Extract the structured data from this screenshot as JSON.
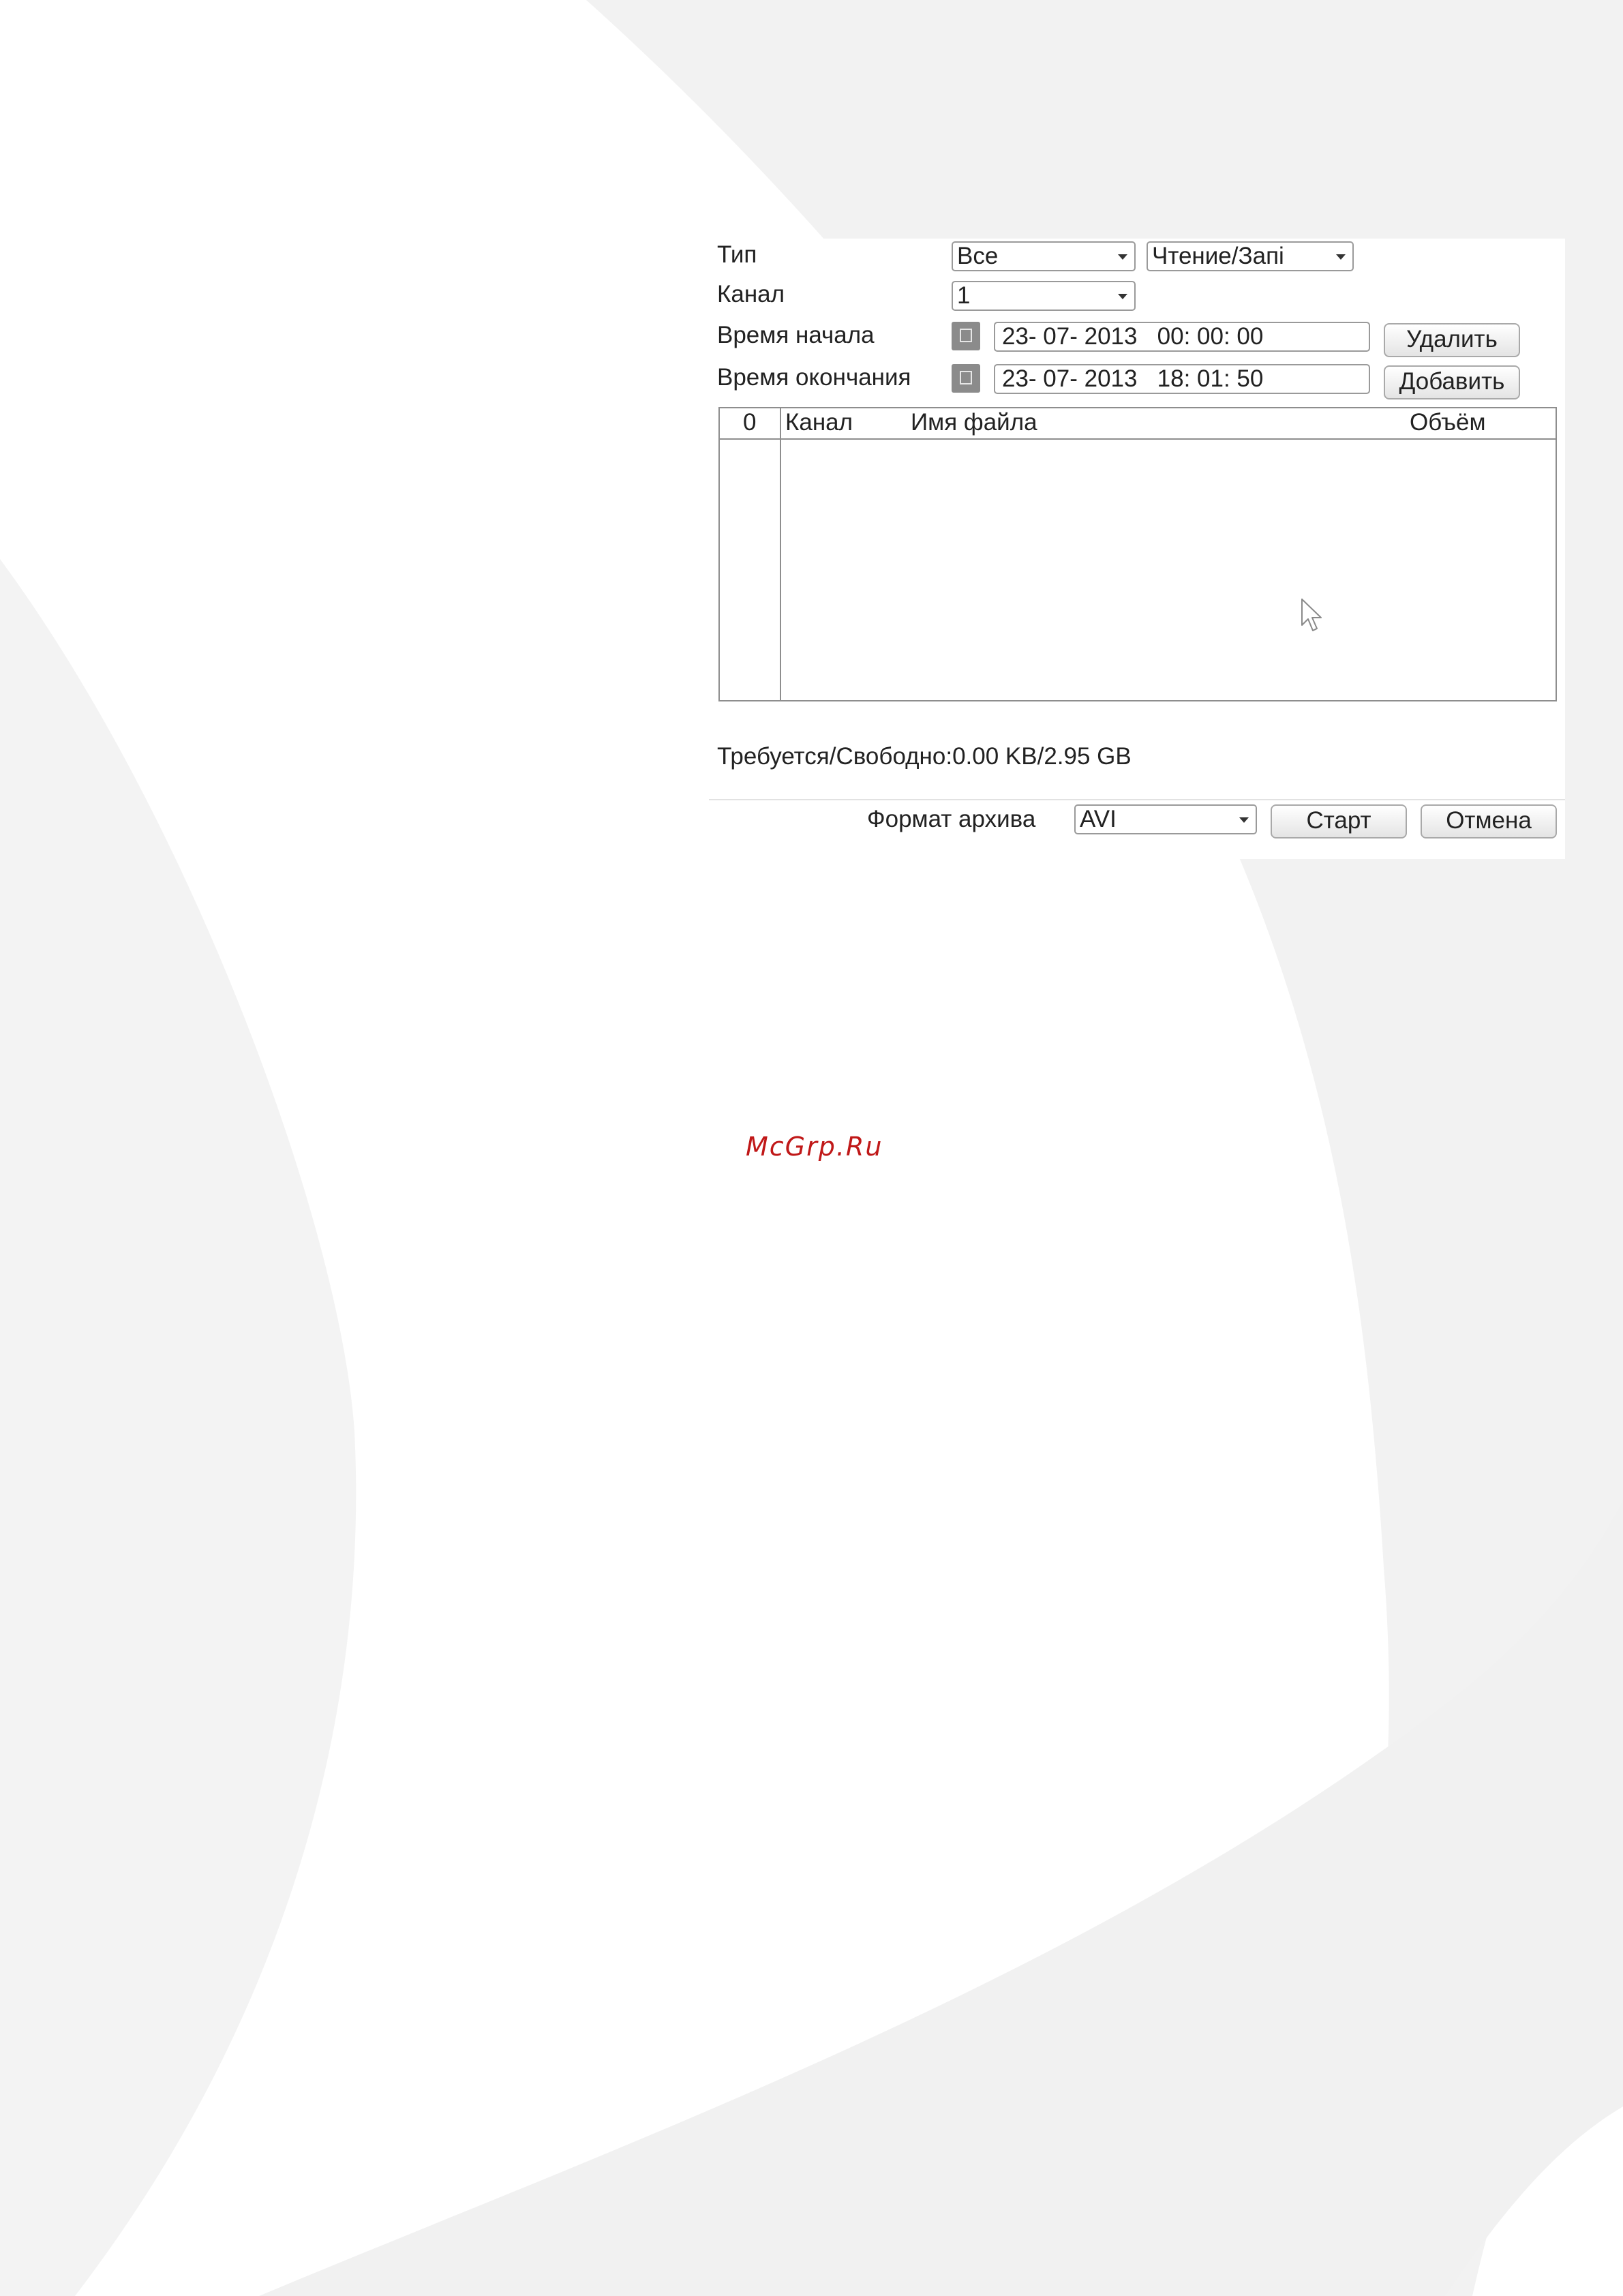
{
  "form": {
    "type_label": "Тип",
    "type_value": "Все",
    "mode_value": "Чтение/Запі",
    "channel_label": "Канал",
    "channel_value": "1",
    "start_label": "Время начала",
    "start_value": "23- 07- 2013   00: 00: 00",
    "end_label": "Время окончания",
    "end_value": "23- 07- 2013   18: 01: 50",
    "delete_button": "Удалить",
    "add_button": "Добавить"
  },
  "table": {
    "columns": [
      "0",
      "Канал",
      "Имя файла",
      "Объём"
    ],
    "rows": []
  },
  "status_text": "Требуется/Свободно:0.00 KB/2.95 GB",
  "footer": {
    "format_label": "Формат архива",
    "format_value": "AVI",
    "start_button": "Старт",
    "cancel_button": "Отмена"
  },
  "watermark": "McGrp.Ru",
  "colors": {
    "background_swirl": "#f1f1f1",
    "watermark": "#c01818",
    "border": "#9a9a9a"
  },
  "icons": [
    "calendar-icon",
    "dropdown-arrow-icon",
    "mouse-cursor-icon"
  ]
}
